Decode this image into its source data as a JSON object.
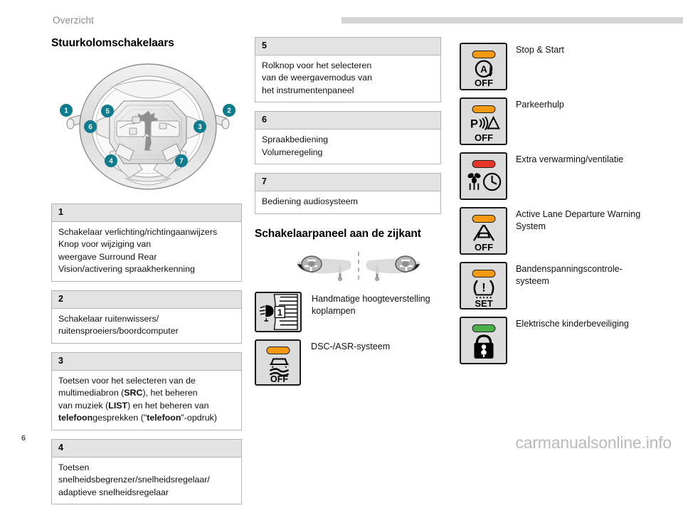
{
  "header": {
    "breadcrumb": "Overzicht"
  },
  "footer": {
    "page_number": "6",
    "watermark": "carmanualsonline.info"
  },
  "colors": {
    "accent_teal": "#0e7c8c",
    "led_orange": "#f59a12",
    "led_red": "#e8352a",
    "led_green": "#4bb04b",
    "header_band": "#d4d4d4",
    "table_header_bg": "#e3e3e3",
    "table_border": "#b5b5b5",
    "switch_face": "#dcdcdc"
  },
  "left_column": {
    "title": "Stuurkolomschakelaars",
    "figure": {
      "name": "steering-wheel-diagram",
      "callouts": [
        "1",
        "2",
        "3",
        "4",
        "5",
        "6",
        "7"
      ]
    },
    "tables": [
      {
        "number": "1",
        "lines": [
          "Schakelaar verlichting/richtingaanwijzers",
          "Knop voor wijziging van",
          "weergave Surround Rear",
          "Vision/activering spraakherkenning"
        ]
      },
      {
        "number": "2",
        "lines": [
          "Schakelaar ruitenwissers/",
          "ruitensproeiers/boordcomputer"
        ]
      },
      {
        "number": "3",
        "lines": [
          "Toetsen voor het selecteren van de",
          "multimediabron (SRC), het beheren",
          "van muziek (LIST) en het beheren van",
          "telefoongesprekken (\"telefoon\"-opdruk)"
        ],
        "bold_terms": [
          "SRC",
          "LIST",
          "telefoon"
        ]
      },
      {
        "number": "4",
        "lines": [
          "Toetsen snelheidsbegrenzer/snelheidsregelaar/",
          "adaptieve snelheidsregelaar"
        ]
      }
    ]
  },
  "middle_column": {
    "tables": [
      {
        "number": "5",
        "lines": [
          "Rolknop voor het selecteren",
          "van de weergavemodus van",
          "het instrumentenpaneel"
        ]
      },
      {
        "number": "6",
        "lines": [
          "Spraakbediening",
          "Volumeregeling"
        ]
      },
      {
        "number": "7",
        "lines": [
          "Bediening audiosysteem"
        ]
      }
    ],
    "section_title": "Schakelaarpaneel aan de zijkant",
    "figure": {
      "name": "dashboard-side-panel-location-diagram"
    },
    "switches": [
      {
        "icon": "headlamp-levelling-wheel-icon",
        "wheel_position": "1",
        "label": "Handmatige hoogteverstelling\nkoplampen",
        "led": "none"
      },
      {
        "icon": "dsc-asr-off-icon",
        "label": "DSC-/ASR-systeem",
        "led_color": "#f59a12",
        "sublabel": "OFF"
      }
    ]
  },
  "right_column": {
    "switches": [
      {
        "icon": "stop-start-off-icon",
        "label": "Stop & Start",
        "led_color": "#f59a12",
        "glyph_text": "A",
        "sublabel": "OFF"
      },
      {
        "icon": "park-assist-off-icon",
        "label": "Parkeerhulp",
        "led_color": "#f59a12",
        "glyph_text": "P",
        "sublabel": "OFF"
      },
      {
        "icon": "auxiliary-heating-ventilation-icon",
        "label": "Extra verwarming/ventilatie",
        "led_color": "#e8352a",
        "sublabel": ""
      },
      {
        "icon": "lane-departure-warning-off-icon",
        "label": "Active Lane Departure Warning\nSystem",
        "led_color": "#f59a12",
        "sublabel": "OFF"
      },
      {
        "icon": "tyre-pressure-monitoring-set-icon",
        "label": "Bandenspanningscontrole-\nsysteem",
        "led_color": "#f59a12",
        "sublabel": "SET"
      },
      {
        "icon": "electric-child-lock-icon",
        "label": "Elektrische kinderbeveiliging",
        "led_color": "#4bb04b",
        "sublabel": ""
      }
    ]
  }
}
